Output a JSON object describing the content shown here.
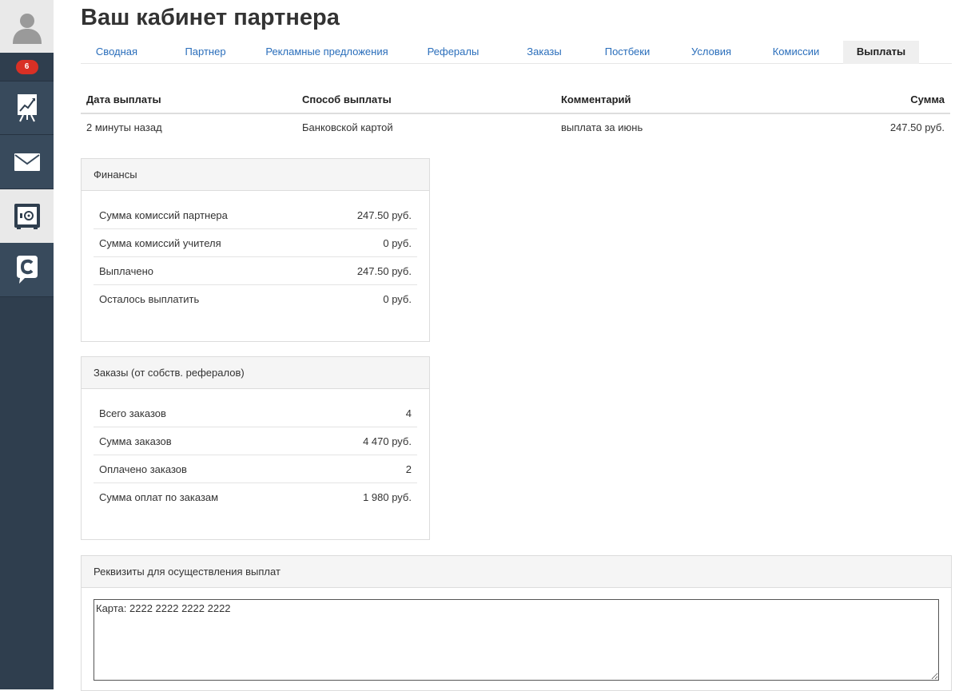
{
  "sidebar": {
    "badge_count": "6",
    "items": [
      {
        "icon": "user-avatar-icon"
      },
      {
        "icon": "chart-icon"
      },
      {
        "icon": "mail-icon"
      },
      {
        "icon": "safe-icon"
      },
      {
        "icon": "brand-logo-icon"
      }
    ]
  },
  "header": {
    "title": "Ваш кабинет партнера"
  },
  "tabs": [
    {
      "label": "Сводная"
    },
    {
      "label": "Партнер"
    },
    {
      "label": "Рекламные предложения"
    },
    {
      "label": "Рефералы"
    },
    {
      "label": "Заказы"
    },
    {
      "label": "Постбеки"
    },
    {
      "label": "Условия"
    },
    {
      "label": "Комиссии"
    },
    {
      "label": "Выплаты",
      "active": true
    }
  ],
  "payouts": {
    "columns": [
      "Дата выплаты",
      "Способ выплаты",
      "Комментарий",
      "Сумма"
    ],
    "rows": [
      {
        "date": "2 минуты назад",
        "method": "Банковской картой",
        "comment": "выплата за июнь",
        "amount": "247.50 руб."
      }
    ]
  },
  "finance": {
    "heading": "Финансы",
    "rows": [
      {
        "label": "Сумма комиссий партнера",
        "value": "247.50 руб."
      },
      {
        "label": "Сумма комиссий учителя",
        "value": "0 руб."
      },
      {
        "label": "Выплачено",
        "value": "247.50 руб."
      },
      {
        "label": "Осталось выплатить",
        "value": "0 руб."
      }
    ]
  },
  "orders": {
    "heading": "Заказы (от собств. рефералов)",
    "rows": [
      {
        "label": "Всего заказов",
        "value": "4"
      },
      {
        "label": "Сумма заказов",
        "value": "4 470 руб."
      },
      {
        "label": "Оплачено заказов",
        "value": "2"
      },
      {
        "label": "Сумма оплат по заказам",
        "value": "1 980 руб."
      }
    ]
  },
  "requisites": {
    "heading": "Реквизиты для осуществления выплат",
    "value": "Карта: 2222 2222 2222 2222"
  },
  "colors": {
    "sidebar_bg": "#2f3e4e",
    "accent_link": "#2a6ebb",
    "badge": "#d93025"
  }
}
